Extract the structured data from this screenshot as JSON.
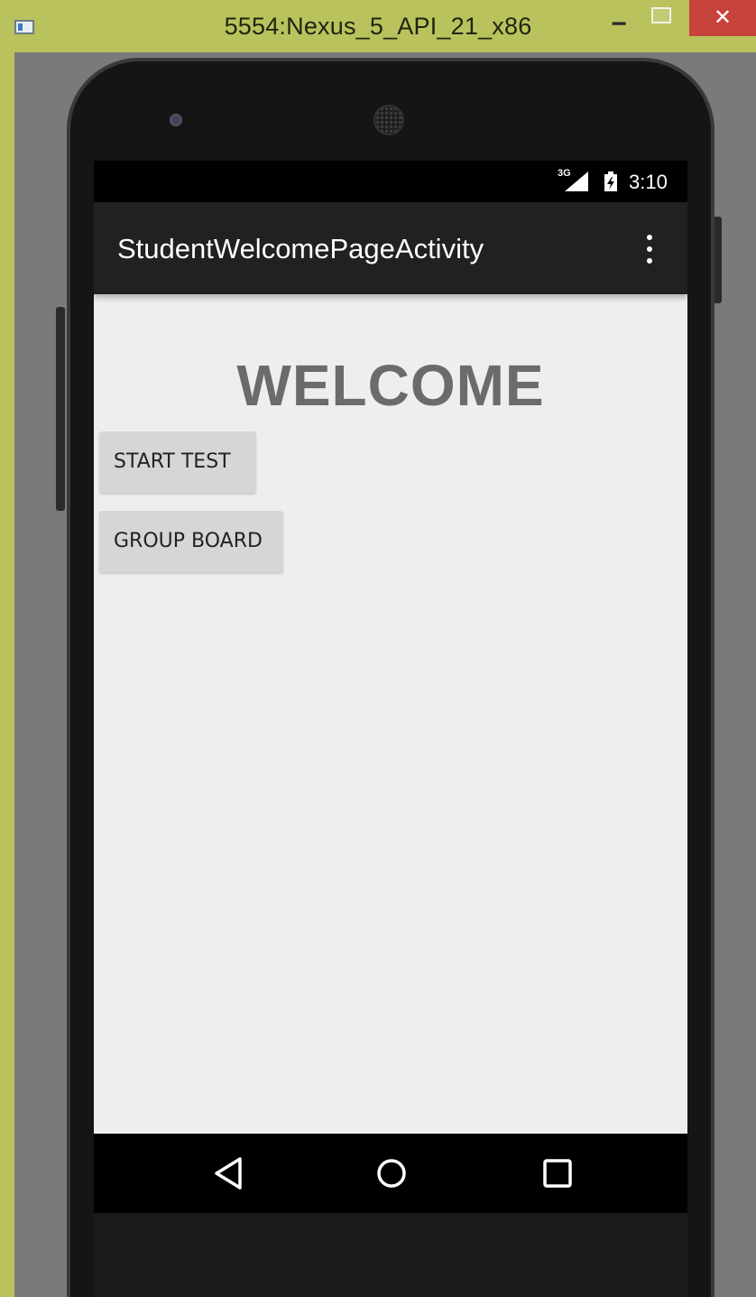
{
  "window": {
    "title": "5554:Nexus_5_API_21_x86",
    "minimize_glyph": "−",
    "close_glyph": "✕"
  },
  "statusbar": {
    "network_type": "3G",
    "time": "3:10"
  },
  "appbar": {
    "title": "StudentWelcomePageActivity",
    "overflow_icon": "more-vert-icon"
  },
  "content": {
    "heading": "WELCOME",
    "buttons": [
      {
        "label": "START TEST"
      },
      {
        "label": "GROUP BOARD"
      }
    ]
  },
  "navbar": {
    "back_icon": "back-triangle-icon",
    "home_icon": "home-circle-icon",
    "recents_icon": "recents-square-icon"
  },
  "colors": {
    "titlebar": "#b9c25c",
    "close_button": "#c7433c",
    "appbar": "#212121",
    "screen_bg": "#eeeeee",
    "button_bg": "#d6d6d6",
    "heading": "#6b6b6b"
  }
}
